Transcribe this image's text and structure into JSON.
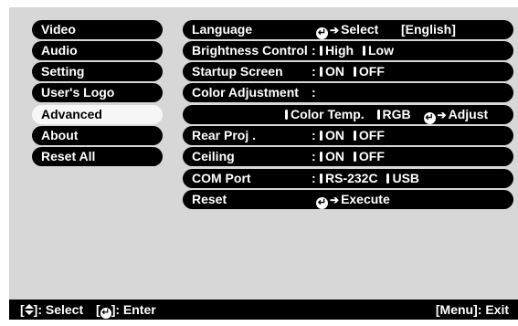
{
  "sidebar": {
    "items": [
      {
        "label": "Video"
      },
      {
        "label": "Audio"
      },
      {
        "label": "Setting"
      },
      {
        "label": "User's Logo"
      },
      {
        "label": "Advanced"
      },
      {
        "label": "About"
      },
      {
        "label": "Reset All"
      }
    ],
    "selected_label": "Advanced"
  },
  "rows": {
    "language": {
      "label": "Language",
      "action": "Select",
      "value": "[English]"
    },
    "brightness": {
      "label": "Brightness Control",
      "sep": ":",
      "opt1": "High",
      "opt2": "Low"
    },
    "startup": {
      "label": "Startup Screen",
      "sep": ":",
      "opt1": "ON",
      "opt2": "OFF"
    },
    "color_adj": {
      "label": "Color Adjustment",
      "sep": ":"
    },
    "color_sub": {
      "opt1": "Color Temp.",
      "opt2": "RGB",
      "action": "Adjust"
    },
    "rear": {
      "label": "Rear Proj .",
      "sep": ":",
      "opt1": "ON",
      "opt2": "OFF"
    },
    "ceiling": {
      "label": "Ceiling",
      "sep": ":",
      "opt1": "ON",
      "opt2": "OFF"
    },
    "com": {
      "label": "COM Port",
      "sep": ":",
      "opt1": "RS-232C",
      "opt2": "USB"
    },
    "reset": {
      "label": "Reset",
      "action": "Execute"
    }
  },
  "footer": {
    "select_prefix": "[",
    "select_suffix": "]: Select",
    "enter_prefix": "[",
    "enter_suffix": "]: Enter",
    "exit": "[Menu]: Exit"
  },
  "colors": {
    "background": "#d7d7d7",
    "pill": "#000000",
    "selected": "#f7f7f7"
  },
  "icons": {
    "enter": "enter-icon",
    "arrow": "right-arrow-icon",
    "updown": "up-down-icon"
  }
}
